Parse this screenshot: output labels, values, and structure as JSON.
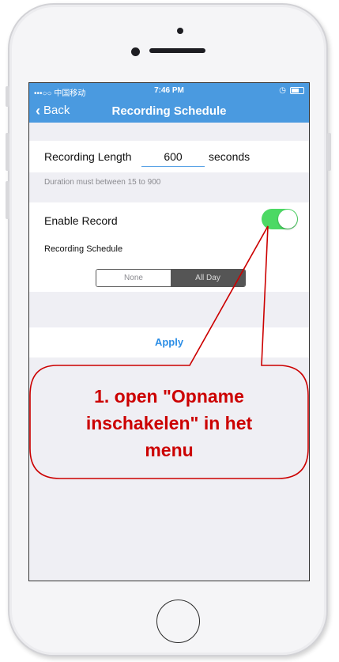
{
  "status_bar": {
    "carrier": "•••○○ 中国移动",
    "time": "7:46 PM"
  },
  "nav": {
    "back_label": "Back",
    "title": "Recording Schedule"
  },
  "recording": {
    "length_label": "Recording Length",
    "length_value": "600",
    "unit": "seconds",
    "hint": "Duration must between 15 to 900"
  },
  "schedule": {
    "enable_label": "Enable Record",
    "enable_on": true,
    "schedule_label": "Recording Schedule",
    "options": [
      "None",
      "All Day"
    ],
    "selected": "All Day"
  },
  "apply_label": "Apply",
  "annotation": {
    "lines": [
      "1. open \"Opname",
      "inschakelen\" in het",
      "menu"
    ],
    "color": "#cc0000"
  },
  "colors": {
    "nav_bar": "#4a9ae0",
    "toggle_on": "#4cd964",
    "apply_text": "#2c8ee6"
  }
}
